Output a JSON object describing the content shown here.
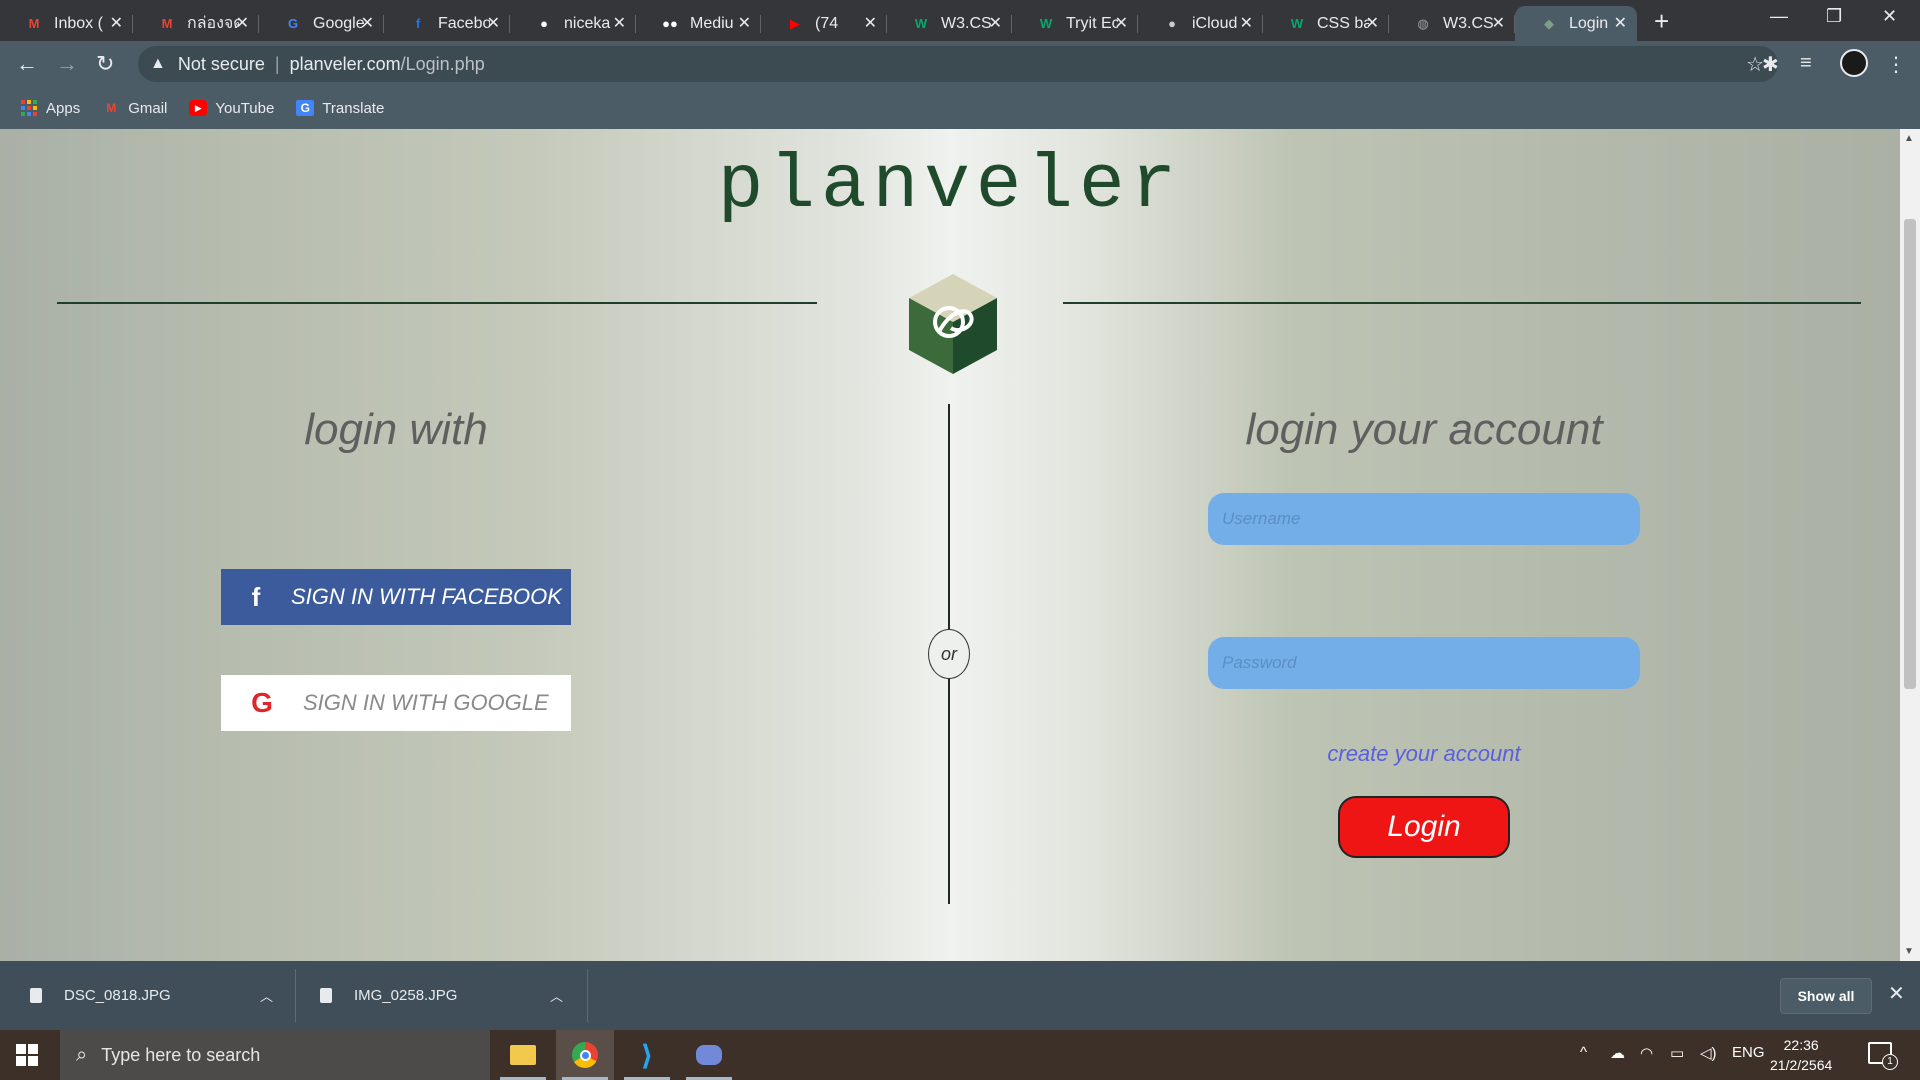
{
  "browser": {
    "tabs": [
      {
        "title": "Inbox (",
        "icon": "gmail-icon",
        "color": "#ea4335",
        "glyph": "M"
      },
      {
        "title": "กล่องจด",
        "icon": "gmail-icon",
        "color": "#ea4335",
        "glyph": "M"
      },
      {
        "title": "Google",
        "icon": "google-translate-icon",
        "color": "#4285f4",
        "glyph": "G"
      },
      {
        "title": "Facebo",
        "icon": "facebook-icon",
        "color": "#1877f2",
        "glyph": "f"
      },
      {
        "title": "niceka",
        "icon": "github-icon",
        "color": "#ffffff",
        "glyph": "●"
      },
      {
        "title": "Mediu",
        "icon": "medium-icon",
        "color": "#ffffff",
        "glyph": "●●"
      },
      {
        "title": "(74",
        "icon": "youtube-icon",
        "color": "#ff0000",
        "glyph": "▶"
      },
      {
        "title": "W3.CS",
        "icon": "w3schools-icon",
        "color": "#04aa6d",
        "glyph": "W"
      },
      {
        "title": "Tryit Ec",
        "icon": "w3schools-icon",
        "color": "#04aa6d",
        "glyph": "W"
      },
      {
        "title": "iCloud",
        "icon": "apple-icon",
        "color": "#cccccc",
        "glyph": "●"
      },
      {
        "title": "CSS ba",
        "icon": "w3schools-icon",
        "color": "#04aa6d",
        "glyph": "W"
      },
      {
        "title": "W3.CS",
        "icon": "globe-icon",
        "color": "#9aa0a6",
        "glyph": "◍"
      },
      {
        "title": "Login",
        "icon": "planveler-icon",
        "color": "#7f9f83",
        "glyph": "◆",
        "active": true
      }
    ],
    "new_tab_label": "+",
    "security_label": "Not secure",
    "url_host": "planveler.com",
    "url_path": "/Login.php",
    "bookmarks": [
      {
        "label": "Apps",
        "icon": "apps-grid-icon"
      },
      {
        "label": "Gmail",
        "icon": "gmail-icon"
      },
      {
        "label": "YouTube",
        "icon": "youtube-icon"
      },
      {
        "label": "Translate",
        "icon": "google-translate-icon"
      }
    ]
  },
  "page": {
    "brand": "planveler",
    "login_with_heading": "login with",
    "facebook_button": "SIGN IN WITH FACEBOOK",
    "google_button": "SIGN IN WITH GOOGLE",
    "divider_text": "or",
    "account_heading": "login your account",
    "username_placeholder": "Username",
    "password_placeholder": "Password",
    "create_account_link": "create your account",
    "login_button": "Login",
    "colors": {
      "facebook": "#3b5b9c",
      "login": "#f01515",
      "input": "#74aee8",
      "brand": "#1f4a2c"
    }
  },
  "downloads": {
    "items": [
      {
        "name": "DSC_0818.JPG"
      },
      {
        "name": "IMG_0258.JPG"
      }
    ],
    "show_all": "Show all"
  },
  "taskbar": {
    "search_placeholder": "Type here to search",
    "apps": [
      "file-explorer-icon",
      "chrome-icon",
      "vscode-icon",
      "discord-icon"
    ],
    "language": "ENG",
    "time": "22:36",
    "date": "21/2/2564",
    "notification_count": "1"
  }
}
